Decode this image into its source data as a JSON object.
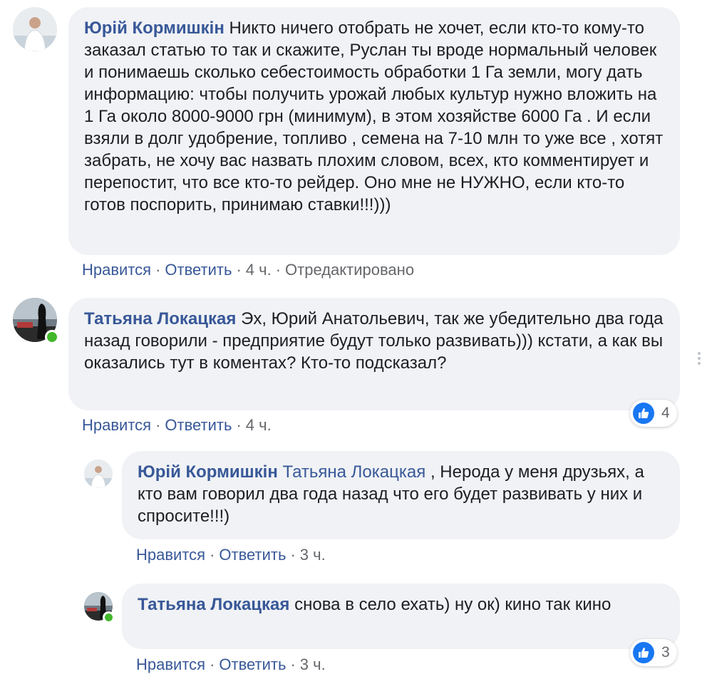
{
  "comments": [
    {
      "author": "Юрій Кормишкін",
      "text": "Никто ничего отобрать не хочет, если кто-то кому-то заказал статью то так и скажите, Руслан ты вроде нормальный человек и понимаешь сколько себестоимость обработки 1 Га земли, могу дать информацию: чтобы получить урожай любых культур нужно вложить на 1 Га около 8000-9000 грн (минимум), в этом хозяйстве 6000 Га . И если взяли в долг удобрение, топливо , семена на 7-10 млн то уже все , хотят забрать, не хочу вас назвать плохим словом, всех, кто комментирует и перепостит, что все кто-то рейдер. Оно мне не НУЖНО, если кто-то готов поспорить, принимаю ставки!!!)))",
      "like_label": "Нравится",
      "reply_label": "Ответить",
      "time": "4 ч.",
      "edited": "Отредактировано"
    },
    {
      "author": "Татьяна Локацкая",
      "text": "Эх, Юрий Анатольевич, так же убедительно два года назад говорили - предприятие будут только развивать))) кстати, а как вы оказались тут в коментах? Кто-то подсказал?",
      "like_label": "Нравится",
      "reply_label": "Ответить",
      "time": "4 ч.",
      "reaction_count": "4"
    },
    {
      "author": "Юрій Кормишкін",
      "mention": "Татьяна Локацкая",
      "text": ", Нерода у меня друзьях, а кто вам говорил два года назад что его будет развивать у них и спросите!!!)",
      "like_label": "Нравится",
      "reply_label": "Ответить",
      "time": "3 ч."
    },
    {
      "author": "Татьяна Локацкая",
      "text": "снова в село ехать) ну ок) кино так кино",
      "like_label": "Нравится",
      "reply_label": "Ответить",
      "time": "3 ч.",
      "reaction_count": "3"
    }
  ],
  "colors": {
    "link": "#385898",
    "bubble": "#f0f2f5",
    "like_blue": "#1877f2",
    "online_green": "#42b72a",
    "meta_gray": "#65676b"
  },
  "icons": {
    "reaction": "like-thumb-icon",
    "online": "online-status-icon",
    "options": "more-options-icon"
  }
}
